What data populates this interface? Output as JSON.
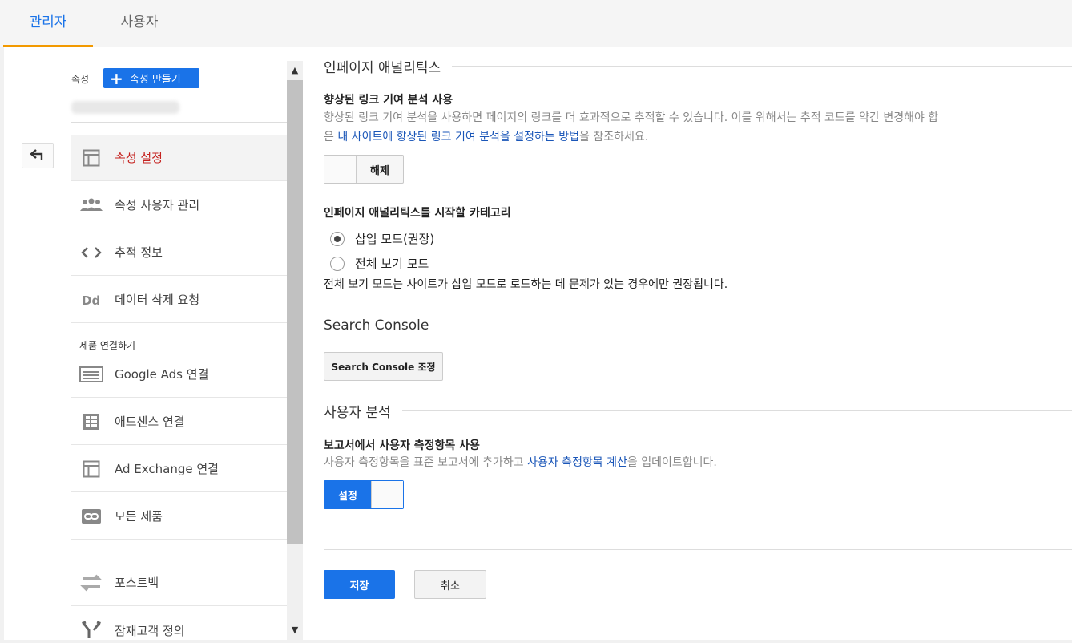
{
  "tabs": [
    "관리자",
    "사용자"
  ],
  "sidebar": {
    "property_label": "속성",
    "create_button": "속성 만들기",
    "items": [
      {
        "label": "속성 설정",
        "icon": "layout-icon"
      },
      {
        "label": "속성 사용자 관리",
        "icon": "people-icon"
      },
      {
        "label": "추적 정보",
        "icon": "code-icon"
      },
      {
        "label": "데이터 삭제 요청",
        "icon": "dd-icon"
      }
    ],
    "section": "제품 연결하기",
    "links": [
      {
        "label": "Google Ads 연결",
        "icon": "ads-icon"
      },
      {
        "label": "애드센스 연결",
        "icon": "adsense-icon"
      },
      {
        "label": "Ad Exchange 연결",
        "icon": "adexchange-icon"
      },
      {
        "label": "모든 제품",
        "icon": "link-icon"
      }
    ],
    "extra": [
      {
        "label": "포스트백",
        "icon": "postback-icon"
      },
      {
        "label": "잠재고객 정의",
        "icon": "audience-icon"
      }
    ]
  },
  "main": {
    "section1_title": "인페이지 애널리틱스",
    "enhanced_title": "향상된 링크 기여 분석 사용",
    "enhanced_desc1": "향상된 링크 기여 분석을 사용하면 페이지의 링크를 더 효과적으로 추적할 수 있습니다. 이를 위해서는 추적 코드를 약간 변경해야 합",
    "enhanced_desc2_pre": "은 ",
    "enhanced_desc2_link": "내 사이트에 향상된 링크 기여 분석을 설정하는 방법",
    "enhanced_desc2_post": "을 참조하세요.",
    "enhanced_toggle": "해제",
    "category_title": "인페이지 애널리틱스를 시작할 카테고리",
    "radio1": "삽입 모드(권장)",
    "radio2": "전체 보기 모드",
    "fullview_note": "전체 보기 모드는 사이트가 삽입 모드로 로드하는 데 문제가 있는 경우에만 권장됩니다.",
    "section2_title": "Search Console",
    "search_console_button": "Search Console 조정",
    "section3_title": "사용자 분석",
    "user_metrics_title": "보고서에서 사용자 측정항목 사용",
    "user_metrics_desc_pre": "사용자 측정항목을 표준 보고서에 추가하고 ",
    "user_metrics_desc_link": "사용자 측정항목 계산",
    "user_metrics_desc_post": "을 업데이트합니다.",
    "user_metrics_toggle": "설정",
    "save_button": "저장",
    "cancel_button": "취소"
  },
  "colors": {
    "accent": "#1a73e8",
    "active_nav": "#c5221f",
    "tab_underline": "#f29900"
  }
}
